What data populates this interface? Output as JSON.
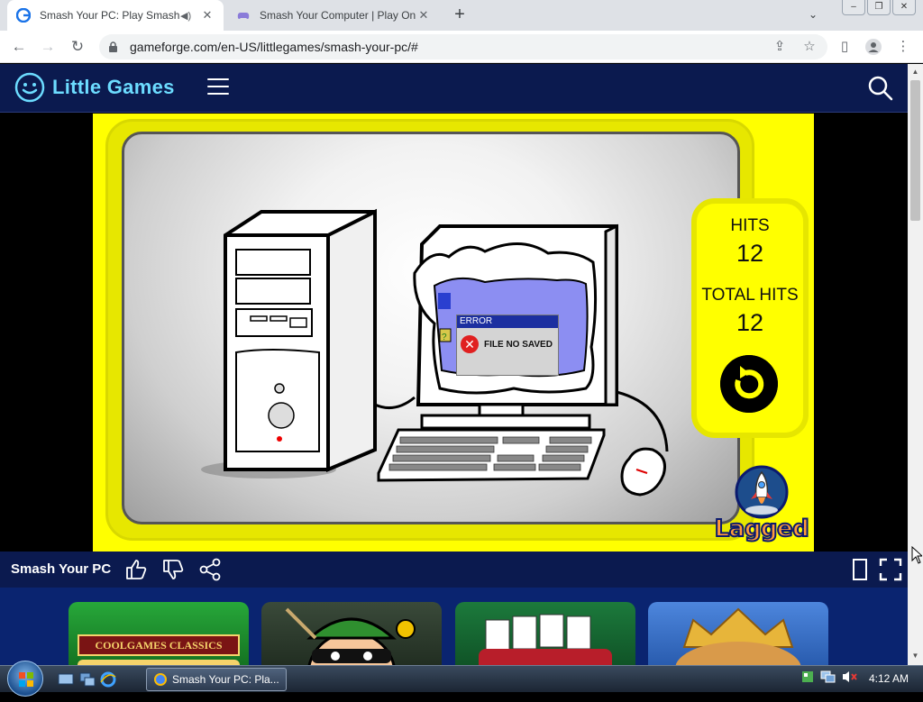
{
  "browser": {
    "tabs": [
      {
        "title": "Smash Your PC: Play Smash Y",
        "active": true,
        "audio": true
      },
      {
        "title": "Smash Your Computer | Play Onl",
        "active": false
      }
    ],
    "url": "gameforge.com/en-US/littlegames/smash-your-pc/#"
  },
  "site": {
    "logo_text": "Little Games",
    "brand_color": "#6cdcff",
    "header_color": "#0b1a4f"
  },
  "game": {
    "hits_label": "HITS",
    "hits_value": "12",
    "total_hits_label": "TOTAL HITS",
    "total_hits_value": "12",
    "error_title": "ERROR",
    "error_message": "FILE NO SAVED",
    "publisher": "Lagged"
  },
  "gamebar": {
    "title": "Smash Your PC"
  },
  "related": [
    {
      "banner": "COOLGAMES CLASSICS",
      "color": "#1a8f2a"
    },
    {
      "banner": "",
      "color": "#2b3b2a"
    },
    {
      "banner": "",
      "color": "#1f6b3a"
    },
    {
      "banner": "",
      "color": "#3a6fc9"
    }
  ],
  "taskbar": {
    "window_title": "Smash Your PC: Pla...",
    "time": "4:12 AM"
  }
}
